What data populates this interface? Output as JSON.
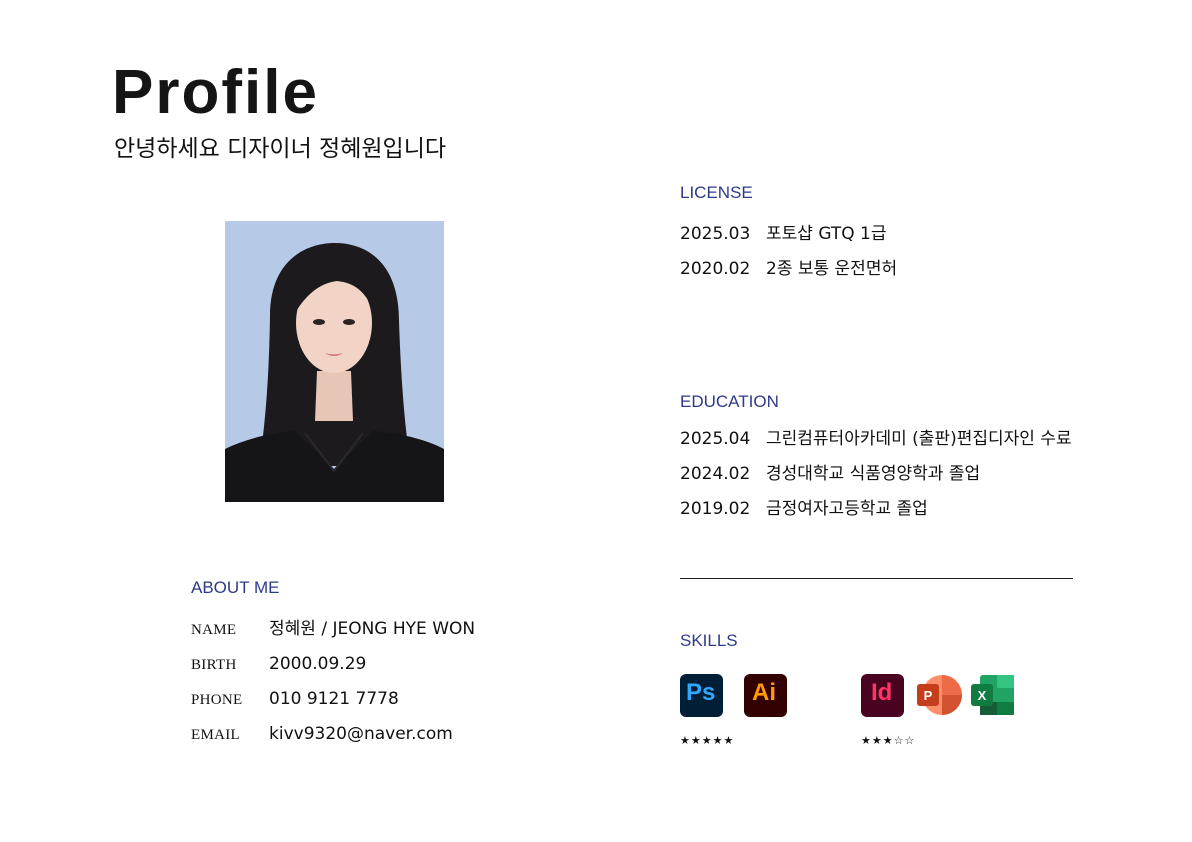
{
  "header": {
    "title": "Profile",
    "subtitle": "안녕하세요 디자이너 정혜원입니다"
  },
  "license": {
    "heading": "LICENSE",
    "items": [
      {
        "date": "2025.03",
        "text": "포토샵 GTQ 1급"
      },
      {
        "date": "2020.02",
        "text": "2종 보통 운전면허"
      }
    ]
  },
  "education": {
    "heading": "EDUCATION",
    "items": [
      {
        "date": "2025.04",
        "text": "그린컴퓨터아카데미 (출판)편집디자인 수료"
      },
      {
        "date": "2024.02",
        "text": "경성대학교 식품영양학과 졸업"
      },
      {
        "date": "2019.02",
        "text": "금정여자고등학교 졸업"
      }
    ]
  },
  "about": {
    "heading": "ABOUT ME",
    "fields": [
      {
        "label": "NAME",
        "value": "정혜원 / JEONG HYE WON"
      },
      {
        "label": "BIRTH",
        "value": "2000.09.29"
      },
      {
        "label": "PHONE",
        "value": "010 9121 7778"
      },
      {
        "label": "EMAIL",
        "value": "kivv9320@naver.com"
      }
    ]
  },
  "skills": {
    "heading": "SKILLS",
    "icons": {
      "ps": {
        "text": "Ps",
        "bg": "#001e36",
        "fg": "#31a8ff"
      },
      "ai": {
        "text": "Ai",
        "bg": "#330000",
        "fg": "#ff9a00"
      },
      "id": {
        "text": "Id",
        "bg": "#49021f",
        "fg": "#ff3366"
      },
      "ppt": {
        "text": "P",
        "color": "#d35230"
      },
      "xls": {
        "text": "X",
        "color": "#107c41"
      }
    },
    "group1_rating": "★★★★★",
    "group2_rating": "★★★☆☆"
  }
}
